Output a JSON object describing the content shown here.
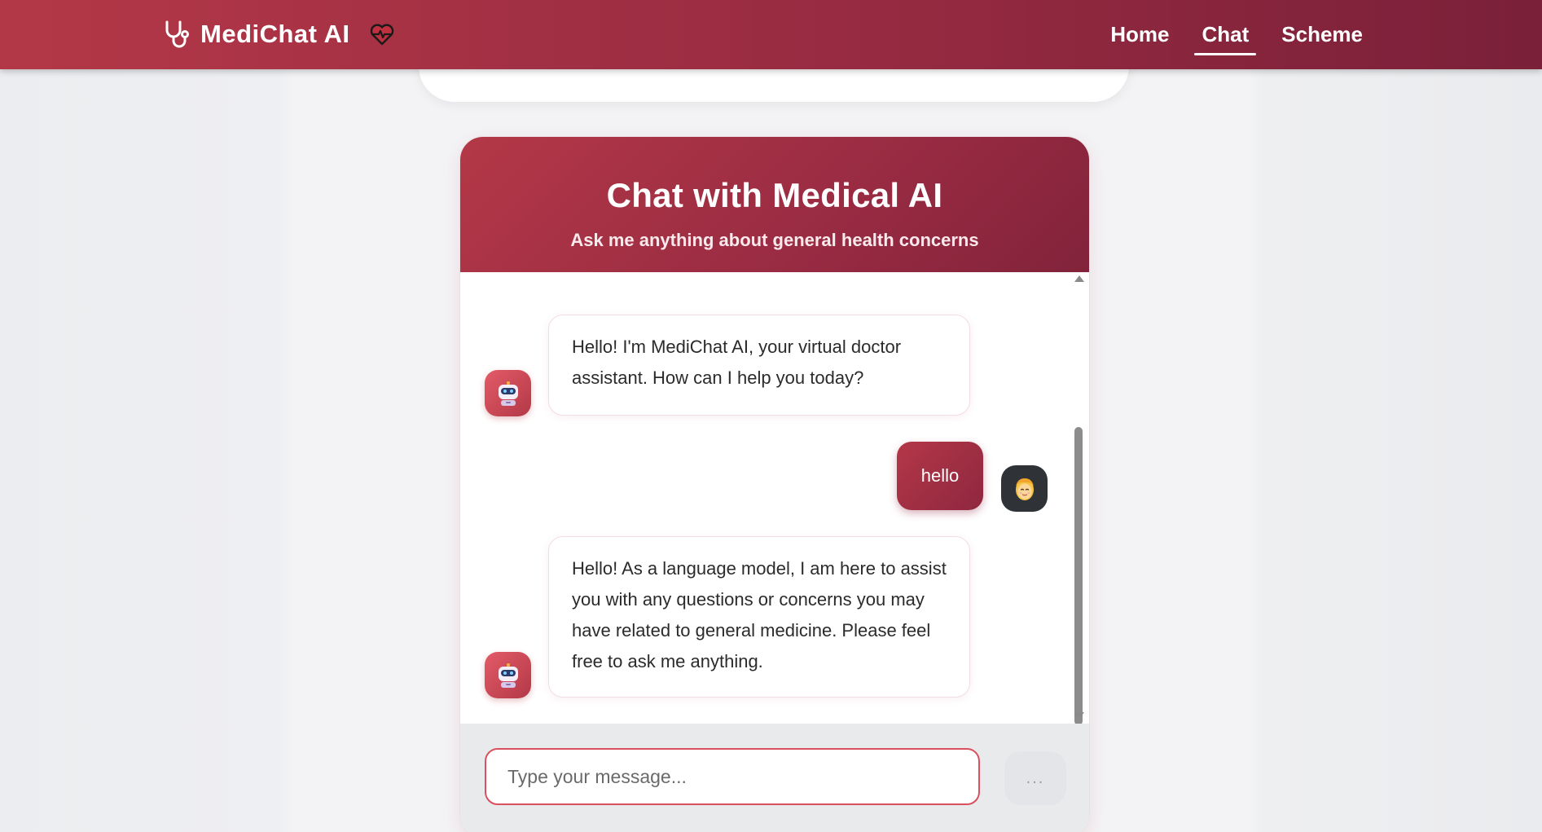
{
  "navbar": {
    "brand_name": "MediChat AI",
    "brand_icon": "stethoscope-icon",
    "badge_icon": "heartbeat-icon",
    "links": [
      {
        "label": "Home",
        "active": false
      },
      {
        "label": "Chat",
        "active": true
      },
      {
        "label": "Scheme",
        "active": false
      }
    ]
  },
  "chat": {
    "title": "Chat with Medical AI",
    "subtitle": "Ask me anything about general health concerns",
    "messages": [
      {
        "sender": "bot",
        "text": "Hello! I'm MediChat AI, your virtual doctor assistant. How can I help you today?"
      },
      {
        "sender": "user",
        "text": "hello"
      },
      {
        "sender": "bot",
        "text": "Hello! As a language model, I am here to assist you with any questions or concerns you may have related to general medicine. Please feel free to ask me anything."
      }
    ],
    "input": {
      "placeholder": "Type your message...",
      "value": ""
    },
    "send_button_label": "..."
  },
  "colors": {
    "primary": "#b33847",
    "primary_dark": "#7a2039",
    "input_border": "#d9505f",
    "page_bg": "#f3f3f5"
  }
}
